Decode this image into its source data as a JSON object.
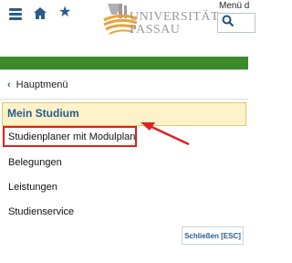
{
  "header": {
    "logo_line1": "UNIVERSITÄT",
    "logo_line2": "PASSAU",
    "menu_label": "Menü d"
  },
  "nav": {
    "back_label": "Hauptmenü",
    "active_item": "Mein Studium",
    "items": [
      {
        "label": "Studienplaner mit Modulplan"
      },
      {
        "label": "Belegungen"
      },
      {
        "label": "Leistungen"
      },
      {
        "label": "Studienservice"
      }
    ]
  },
  "close_button": {
    "label": "Schließen [ESC]"
  },
  "colors": {
    "brand_blue": "#2a5b8c",
    "green_bar": "#3d8a2a",
    "active_bg": "#fdf2c9",
    "annotation_red": "#e02020"
  }
}
